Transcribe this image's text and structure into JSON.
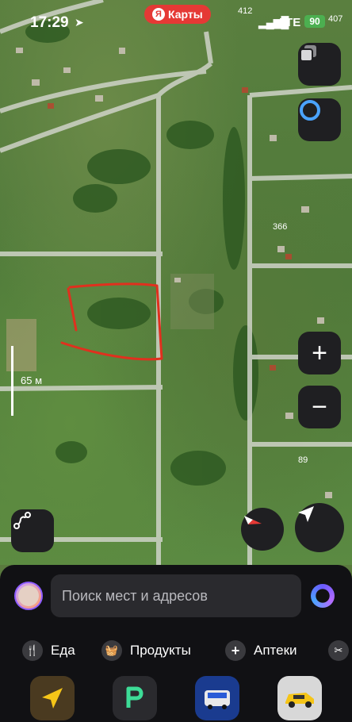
{
  "status": {
    "time": "17:29",
    "network": "LTE",
    "battery": "90"
  },
  "app": {
    "brand_ya": "Я",
    "brand_name": "Карты"
  },
  "map": {
    "house_numbers": [
      "412",
      "407",
      "366",
      "89"
    ],
    "scale_label": "65 м"
  },
  "controls": {
    "zoom_in": "+",
    "zoom_out": "−"
  },
  "search": {
    "placeholder": "Поиск мест и адресов"
  },
  "categories": [
    {
      "label": "Еда",
      "icon": "fork-knife-icon"
    },
    {
      "label": "Продукты",
      "icon": "basket-icon"
    },
    {
      "label": "Аптеки",
      "icon": "pharmacy-cross-icon"
    },
    {
      "label": "",
      "icon": "scissors-icon"
    }
  ],
  "apps": [
    {
      "name": "navigator-app",
      "icon": "arrow-icon"
    },
    {
      "name": "parking-app",
      "icon": "p-icon"
    },
    {
      "name": "transport-app",
      "icon": "bus-icon"
    },
    {
      "name": "taxi-app",
      "icon": "car-icon"
    }
  ],
  "colors": {
    "brand_red": "#e53935",
    "annotation_red": "#e0301e",
    "panel_bg": "#111114",
    "control_bg": "#1f1f22",
    "battery_green": "#4caf50"
  }
}
